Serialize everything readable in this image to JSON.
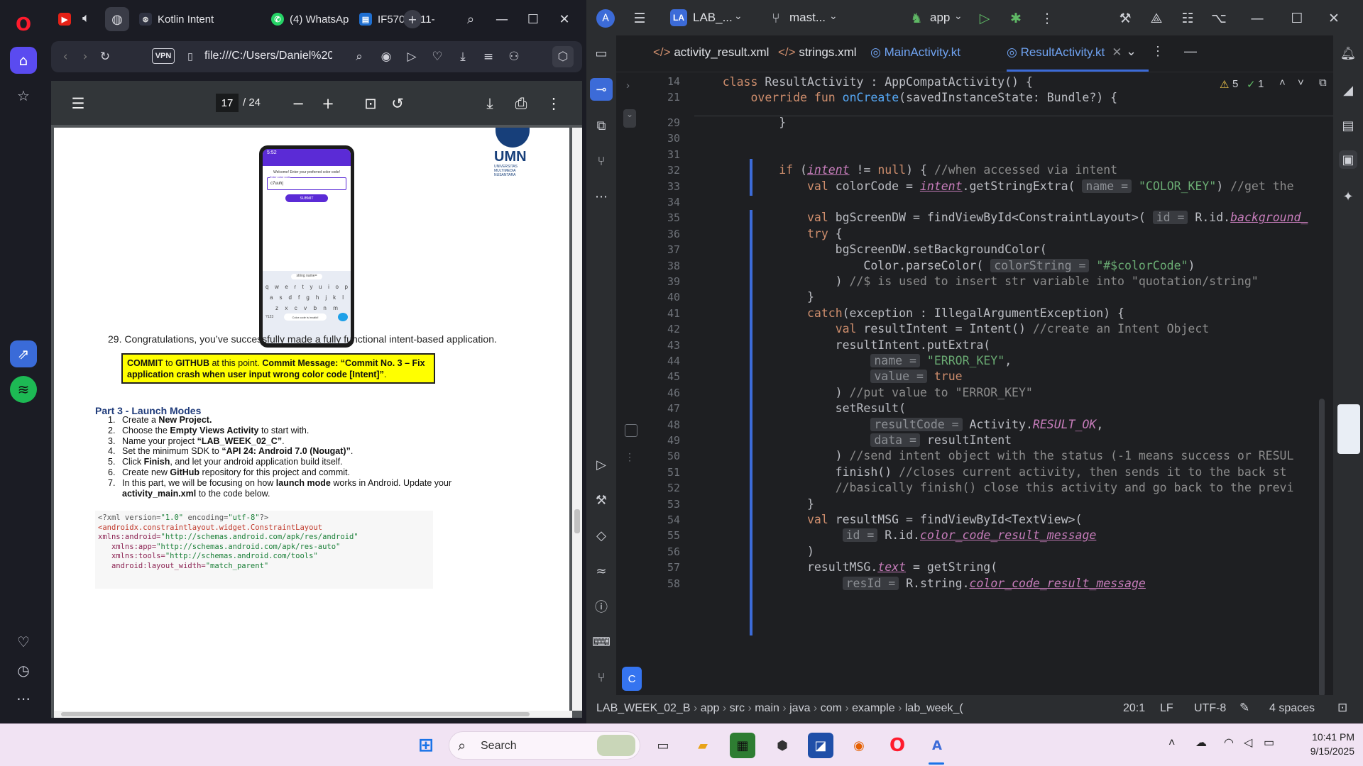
{
  "browser": {
    "tabs": [
      {
        "label": "Kotlin Intent"
      },
      {
        "label": "(4) WhatsAp"
      },
      {
        "label": "IF570-2511-"
      }
    ],
    "address": "file:///C:/Users/Daniel%20",
    "vpn_label": "VPN"
  },
  "pdf": {
    "page_current": "17",
    "page_total": "/ 24",
    "logo_text": "UMN",
    "logo_sub": "UNIVERSITAS MULTIMEDIA NUSANTARA",
    "phone": {
      "status_time": "5:52",
      "welcome": "Welcome! Enter your preferred color code!",
      "input_label": "Enter color code",
      "input_value": "c7uuh|",
      "button": "SUBMIT",
      "suggest": "string name=",
      "toast": "Color code is invalid!",
      "kb_row1": [
        "q",
        "w",
        "e",
        "r",
        "t",
        "y",
        "u",
        "i",
        "o",
        "p"
      ],
      "kb_row2": [
        "a",
        "s",
        "d",
        "f",
        "g",
        "h",
        "j",
        "k",
        "l"
      ],
      "kb_row3": [
        "z",
        "x",
        "c",
        "v",
        "b",
        "n",
        "m"
      ],
      "kb_sym": "?123"
    },
    "step29": "29. Congratulations, you’ve successfully made a fully functional intent-based application.",
    "commit_a": "COMMIT",
    "commit_b": " to ",
    "commit_c": "GITHUB",
    "commit_d": " at this point. ",
    "commit_e": "Commit Message: “Commit No. 3 – Fix application crash when user input wrong color code [Intent]”",
    "commit_f": ".",
    "part3": "Part 3 - Launch Modes",
    "steps": [
      {
        "n": "1.",
        "parts": [
          [
            "Create a ",
            ""
          ],
          [
            "New Project.",
            "b"
          ]
        ]
      },
      {
        "n": "2.",
        "parts": [
          [
            "Choose the ",
            ""
          ],
          [
            "Empty Views Activity",
            "b"
          ],
          [
            " to start with.",
            ""
          ]
        ]
      },
      {
        "n": "3.",
        "parts": [
          [
            "Name your project ",
            ""
          ],
          [
            "“LAB_WEEK_02_C”",
            "b"
          ],
          [
            ".",
            ""
          ]
        ]
      },
      {
        "n": "4.",
        "parts": [
          [
            "Set the minimum SDK to ",
            ""
          ],
          [
            "“API 24: Android 7.0 (Nougat)”",
            "b"
          ],
          [
            ".",
            ""
          ]
        ]
      },
      {
        "n": "5.",
        "parts": [
          [
            "Click ",
            ""
          ],
          [
            "Finish",
            "b"
          ],
          [
            ", and let your android application build itself.",
            ""
          ]
        ]
      },
      {
        "n": "6.",
        "parts": [
          [
            "Create new ",
            ""
          ],
          [
            "GitHub",
            "b"
          ],
          [
            " repository for this project and commit.",
            ""
          ]
        ]
      },
      {
        "n": "7.",
        "parts": [
          [
            "In this part, we will be focusing on how ",
            ""
          ],
          [
            "launch mode",
            "b"
          ],
          [
            " works in Android. Update your",
            ""
          ]
        ]
      },
      {
        "n": "",
        "parts": [
          [
            "activity_main.xml",
            "b"
          ],
          [
            " to the code below.",
            ""
          ]
        ]
      }
    ],
    "xml_lines": [
      "<?xml version=\"1.0\" encoding=\"utf-8\"?>",
      "<androidx.constraintlayout.widget.ConstraintLayout",
      "xmlns:android=\"http://schemas.android.com/apk/res/android\"",
      "   xmlns:app=\"http://schemas.android.com/apk/res-auto\"",
      "   xmlns:tools=\"http://schemas.android.com/tools\"",
      "   android:layout_width=\"match_parent\""
    ]
  },
  "ide": {
    "project_badge": "LA",
    "project": "LAB_...",
    "branch": "mast...",
    "run_config": "app",
    "tabs": [
      "activity_result.xml",
      "strings.xml",
      "MainActivity.kt",
      "ResultActivity.kt"
    ],
    "warnings": "5",
    "checks": "1",
    "sticky": [
      {
        "n": "14",
        "code": "    class ResultActivity : AppCompatActivity() {"
      },
      {
        "n": "21",
        "code": "        override fun onCreate(savedInstanceState: Bundle?) {"
      }
    ],
    "lines": [
      {
        "n": "29",
        "code": "            }"
      },
      {
        "n": "30",
        "code": ""
      },
      {
        "n": "31",
        "code": ""
      },
      {
        "n": "32",
        "code": "            if (intent != null) { //when accessed via intent"
      },
      {
        "n": "33",
        "code": "                val colorCode = intent.getStringExtra( name = \"COLOR_KEY\") //get the"
      },
      {
        "n": "34",
        "code": ""
      },
      {
        "n": "35",
        "code": "                val bgScreenDW = findViewById<ConstraintLayout>( id = R.id.background_"
      },
      {
        "n": "36",
        "code": "                try {"
      },
      {
        "n": "37",
        "code": "                    bgScreenDW.setBackgroundColor("
      },
      {
        "n": "38",
        "code": "                        Color.parseColor( colorString = \"#$colorCode\")"
      },
      {
        "n": "39",
        "code": "                    ) //$ is used to insert str variable into \"quotation/string\""
      },
      {
        "n": "40",
        "code": "                }"
      },
      {
        "n": "41",
        "code": "                catch(exception : IllegalArgumentException) {"
      },
      {
        "n": "42",
        "code": "                    val resultIntent = Intent() //create an Intent Object"
      },
      {
        "n": "43",
        "code": "                    resultIntent.putExtra("
      },
      {
        "n": "44",
        "code": "                         name = \"ERROR_KEY\","
      },
      {
        "n": "45",
        "code": "                         value = true"
      },
      {
        "n": "46",
        "code": "                    ) //put value to \"ERROR_KEY\""
      },
      {
        "n": "47",
        "code": "                    setResult("
      },
      {
        "n": "48",
        "code": "                         resultCode = Activity.RESULT_OK,"
      },
      {
        "n": "49",
        "code": "                         data = resultIntent"
      },
      {
        "n": "50",
        "code": "                    ) //send intent object with the status (-1 means success or RESUL"
      },
      {
        "n": "51",
        "code": "                    finish() //closes current activity, then sends it to the back st"
      },
      {
        "n": "52",
        "code": "                    //basically finish() close this activity and go back to the previ"
      },
      {
        "n": "53",
        "code": "                }"
      },
      {
        "n": "54",
        "code": "                val resultMSG = findViewById<TextView>("
      },
      {
        "n": "55",
        "code": "                     id = R.id.color_code_result_message"
      },
      {
        "n": "56",
        "code": "                )"
      },
      {
        "n": "57",
        "code": "                resultMSG.text = getString("
      },
      {
        "n": "58",
        "code": "                     resId = R.string.color_code_result_message"
      }
    ],
    "status": {
      "breadcrumb": [
        "LAB_WEEK_02_B",
        "app",
        "src",
        "main",
        "java",
        "com",
        "example",
        "lab_week_("
      ],
      "position": "20:1",
      "eol": "LF",
      "encoding": "UTF-8",
      "indent": "4 spaces"
    }
  },
  "taskbar": {
    "search": "Search",
    "time": "10:41 PM",
    "date": "9/15/2025"
  }
}
